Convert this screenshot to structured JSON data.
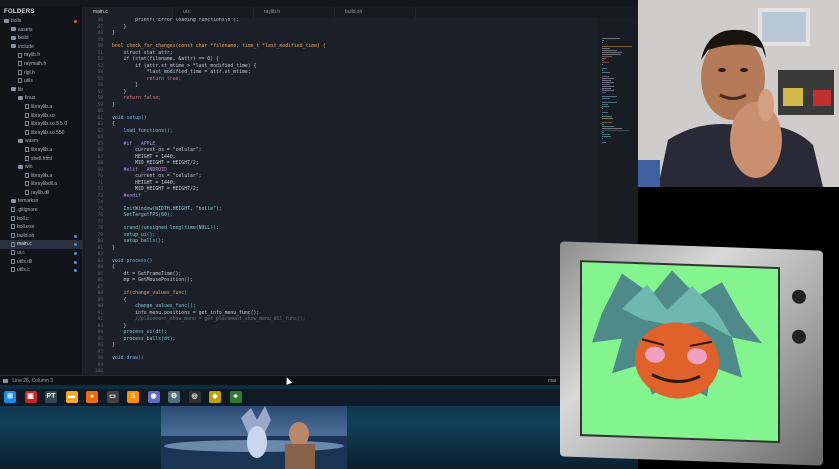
{
  "sidebar": {
    "header": "FOLDERS",
    "items": [
      {
        "label": "bolls",
        "type": "folder",
        "indent": 0,
        "dot": "#e05252"
      },
      {
        "label": "assets",
        "type": "folder",
        "indent": 1
      },
      {
        "label": "build",
        "type": "folder",
        "indent": 1
      },
      {
        "label": "include",
        "type": "folder",
        "indent": 1
      },
      {
        "label": "raylib.h",
        "type": "file",
        "indent": 2
      },
      {
        "label": "raymath.h",
        "type": "file",
        "indent": 2
      },
      {
        "label": "rlgl.h",
        "type": "file",
        "indent": 2
      },
      {
        "label": "utils",
        "type": "file",
        "indent": 2
      },
      {
        "label": "lib",
        "type": "folder",
        "indent": 1
      },
      {
        "label": "linux",
        "type": "folder",
        "indent": 2
      },
      {
        "label": "libraylib.a",
        "type": "file",
        "indent": 3
      },
      {
        "label": "libraylib.so",
        "type": "file",
        "indent": 3
      },
      {
        "label": "libraylib.so.5.5.0",
        "type": "file",
        "indent": 3
      },
      {
        "label": "libraylib.so.550",
        "type": "file",
        "indent": 3
      },
      {
        "label": "wasm",
        "type": "folder",
        "indent": 2
      },
      {
        "label": "libraylib.a",
        "type": "file",
        "indent": 3
      },
      {
        "label": "shell.html",
        "type": "file",
        "indent": 3
      },
      {
        "label": "win",
        "type": "folder",
        "indent": 2
      },
      {
        "label": "libraylib.a",
        "type": "file",
        "indent": 3
      },
      {
        "label": "libraylibdll.a",
        "type": "file",
        "indent": 3
      },
      {
        "label": "raylib.dll",
        "type": "file",
        "indent": 3
      },
      {
        "label": "temarkss",
        "type": "folder",
        "indent": 1
      },
      {
        "label": ".gitignore",
        "type": "file",
        "indent": 1
      },
      {
        "label": "boll.c",
        "type": "file",
        "indent": 1
      },
      {
        "label": "boll.exe",
        "type": "file",
        "indent": 1
      },
      {
        "label": "build.sh",
        "type": "file",
        "indent": 1,
        "dot": "#4a90e2"
      },
      {
        "label": "main.c",
        "type": "file",
        "indent": 1,
        "selected": true,
        "dot": "#4a90e2"
      },
      {
        "label": "ui.c",
        "type": "file",
        "indent": 1,
        "dot": "#4a90e2"
      },
      {
        "label": "utils.dll",
        "type": "file",
        "indent": 1,
        "dot": "#4a90e2"
      },
      {
        "label": "utils.c",
        "type": "file",
        "indent": 1,
        "dot": "#4a90e2"
      }
    ]
  },
  "tabs": [
    {
      "label": "main.c",
      "active": true
    },
    {
      "label": "ui.c",
      "active": false
    },
    {
      "label": "raylib.h",
      "active": false
    },
    {
      "label": "build.sh",
      "active": false
    }
  ],
  "code": {
    "line_numbers": [
      "46",
      "47",
      "48",
      "49",
      "50",
      "51",
      "52",
      "53",
      "54",
      "55",
      "56",
      "57",
      "58",
      "59",
      "60",
      "61",
      "62",
      "63",
      "64",
      "65",
      "66",
      "67",
      "68",
      "69",
      "70",
      "71",
      "72",
      "73",
      "74",
      "75",
      "76",
      "77",
      "78",
      "79",
      "80",
      "81",
      "82",
      "83",
      "84",
      "85",
      "86",
      "87",
      "88",
      "89",
      "90",
      "91",
      "92",
      "93",
      "94",
      "95",
      "96",
      "97",
      "98",
      "99",
      "100"
    ],
    "lines": [
      {
        "text": "        printf(\"Error loading functions\\n\");",
        "color": "#c5cbd5"
      },
      {
        "text": "    }",
        "color": "#c5cbd5"
      },
      {
        "text": "}",
        "color": "#c5cbd5"
      },
      {
        "text": "",
        "color": "#c5cbd5"
      },
      {
        "text": "bool check_for_changes(const char *filename, time_t *last_modified_time) {",
        "color": "#e8a45a"
      },
      {
        "text": "    struct stat attr;",
        "color": "#c5cbd5"
      },
      {
        "text": "    if (stat(filename, &attr) == 0) {",
        "color": "#c5cbd5"
      },
      {
        "text": "        if (attr.st_mtime > *last_modified_time) {",
        "color": "#c5cbd5"
      },
      {
        "text": "            *last_modified_time = attr.st_mtime;",
        "color": "#c5cbd5"
      },
      {
        "text": "            return true;",
        "color": "#e07b7b"
      },
      {
        "text": "        }",
        "color": "#c5cbd5"
      },
      {
        "text": "    }",
        "color": "#c5cbd5"
      },
      {
        "text": "    return false;",
        "color": "#e07b7b"
      },
      {
        "text": "}",
        "color": "#c5cbd5"
      },
      {
        "text": "",
        "color": "#c5cbd5"
      },
      {
        "text": "void setup()",
        "color": "#6fb2e8"
      },
      {
        "text": "{",
        "color": "#c5cbd5"
      },
      {
        "text": "    load_functions();",
        "color": "#7fcad6"
      },
      {
        "text": "",
        "color": "#c5cbd5"
      },
      {
        "text": "    #if __APPLE__",
        "color": "#b48ee0"
      },
      {
        "text": "        current_os = \"celular\";",
        "color": "#c5cbd5"
      },
      {
        "text": "        HEIGHT = 1440;",
        "color": "#c5cbd5"
      },
      {
        "text": "        MID_HEIGHT = HEIGHT/2;",
        "color": "#c5cbd5"
      },
      {
        "text": "    #elif __ANDROID__",
        "color": "#b48ee0"
      },
      {
        "text": "        current_os = \"celular\";",
        "color": "#c5cbd5"
      },
      {
        "text": "        HEIGHT = 1440;",
        "color": "#c5cbd5"
      },
      {
        "text": "        MID_HEIGHT = HEIGHT/2;",
        "color": "#c5cbd5"
      },
      {
        "text": "    #endif",
        "color": "#b48ee0"
      },
      {
        "text": "",
        "color": "#c5cbd5"
      },
      {
        "text": "    InitWindow(WIDTH,HEIGHT, \"bolle\");",
        "color": "#7fcad6"
      },
      {
        "text": "    SetTargetFPS(60);",
        "color": "#7fcad6"
      },
      {
        "text": "",
        "color": "#c5cbd5"
      },
      {
        "text": "    srand((unsigned long)time(NULL));",
        "color": "#7fcad6"
      },
      {
        "text": "    setup_ui();",
        "color": "#7fcad6"
      },
      {
        "text": "    setup_balls();",
        "color": "#7fcad6"
      },
      {
        "text": "}",
        "color": "#c5cbd5"
      },
      {
        "text": "",
        "color": "#c5cbd5"
      },
      {
        "text": "void process()",
        "color": "#6fb2e8"
      },
      {
        "text": "{",
        "color": "#c5cbd5"
      },
      {
        "text": "    dt = GetFrameTime();",
        "color": "#c5cbd5"
      },
      {
        "text": "    mp = GetMousePosition();",
        "color": "#c5cbd5"
      },
      {
        "text": "",
        "color": "#c5cbd5"
      },
      {
        "text": "    if(change_values_func)",
        "color": "#e8a45a"
      },
      {
        "text": "    {",
        "color": "#c5cbd5"
      },
      {
        "text": "        change_values_func();",
        "color": "#7fcad6"
      },
      {
        "text": "        info_menu.positions = get_info_menu_func();",
        "color": "#c5cbd5"
      },
      {
        "text": "        //placement_show_menu = get_placement_show_menu_dll_func();",
        "color": "#6b7280"
      },
      {
        "text": "    }",
        "color": "#c5cbd5"
      },
      {
        "text": "    process_ui(dt);",
        "color": "#7fcad6"
      },
      {
        "text": "    process_balls(dt);",
        "color": "#7fcad6"
      },
      {
        "text": "}",
        "color": "#c5cbd5"
      },
      {
        "text": "",
        "color": "#c5cbd5"
      },
      {
        "text": "void draw()",
        "color": "#6fb2e8"
      }
    ]
  },
  "status": {
    "position": "Line 26, Column 3",
    "syntax": "mai"
  },
  "taskbar": {
    "icons": [
      {
        "name": "windows-start-icon",
        "color": "#1e88e5",
        "glyph": "⊞"
      },
      {
        "name": "app-icon-red",
        "color": "#c62828",
        "glyph": "▣"
      },
      {
        "name": "terminal-icon",
        "color": "#37474f",
        "glyph": "PT"
      },
      {
        "name": "folder-icon",
        "color": "#f9a825",
        "glyph": "▬"
      },
      {
        "name": "firefox-icon",
        "color": "#ef6c00",
        "glyph": "●"
      },
      {
        "name": "terminal-icon-2",
        "color": "#424242",
        "glyph": "▭"
      },
      {
        "name": "sublime-icon",
        "color": "#ff8f00",
        "glyph": "S"
      },
      {
        "name": "discord-icon",
        "color": "#5c6bc0",
        "glyph": "◉"
      },
      {
        "name": "settings-icon",
        "color": "#546e7a",
        "glyph": "⚙"
      },
      {
        "name": "obs-icon",
        "color": "#303030",
        "glyph": "◎"
      },
      {
        "name": "game-icon",
        "color": "#c0a000",
        "glyph": "◆"
      },
      {
        "name": "character-icon",
        "color": "#2e7d32",
        "glyph": "♣"
      }
    ]
  }
}
